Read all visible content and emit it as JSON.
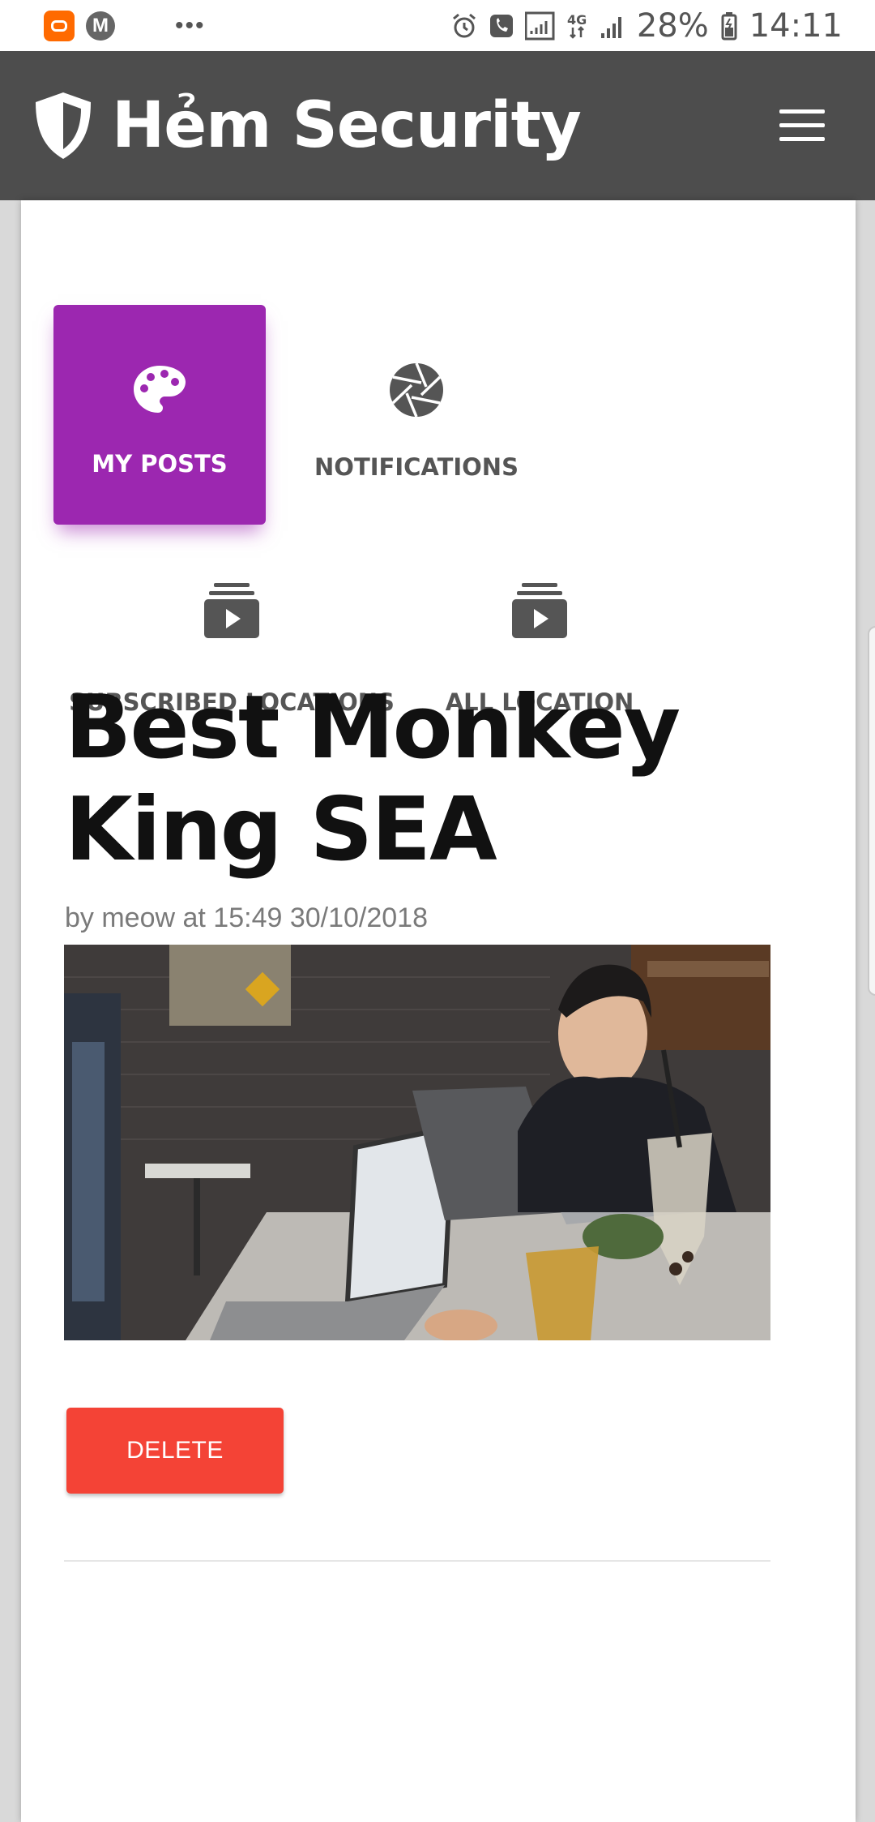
{
  "status_bar": {
    "battery": "28%",
    "time": "14:11",
    "network": "4G",
    "left_icons": [
      "mi-app-icon",
      "m-app-icon",
      "more-dots"
    ],
    "right_icons": [
      "alarm-icon",
      "wifi-calling-icon",
      "signal-icon",
      "4g-icon",
      "signal-icon",
      "battery-icon"
    ]
  },
  "header": {
    "title": "Hẻm Security",
    "background": "#4d4d4d",
    "logo_icon": "shield-icon",
    "menu_icon": "hamburger-menu-icon"
  },
  "tabs": [
    {
      "label": "MY POSTS",
      "icon": "palette-icon",
      "active": true
    },
    {
      "label": "NOTIFICATIONS",
      "icon": "camera-shutter-icon",
      "active": false
    },
    {
      "label": "SUBSCRIBED LOCATIONS",
      "icon": "video-collection-icon",
      "active": false
    },
    {
      "label": "ALL LOCATION",
      "icon": "video-collection-icon",
      "active": false
    }
  ],
  "accent_color": "#9c27b0",
  "post": {
    "title": "Best Monkey King SEA",
    "meta": "by meow at 15:49 30/10/2018",
    "photo": "photo of a man sitting at a cafe table with laptops and drinks",
    "delete_label": "DELETE",
    "delete_color": "#f44336"
  }
}
